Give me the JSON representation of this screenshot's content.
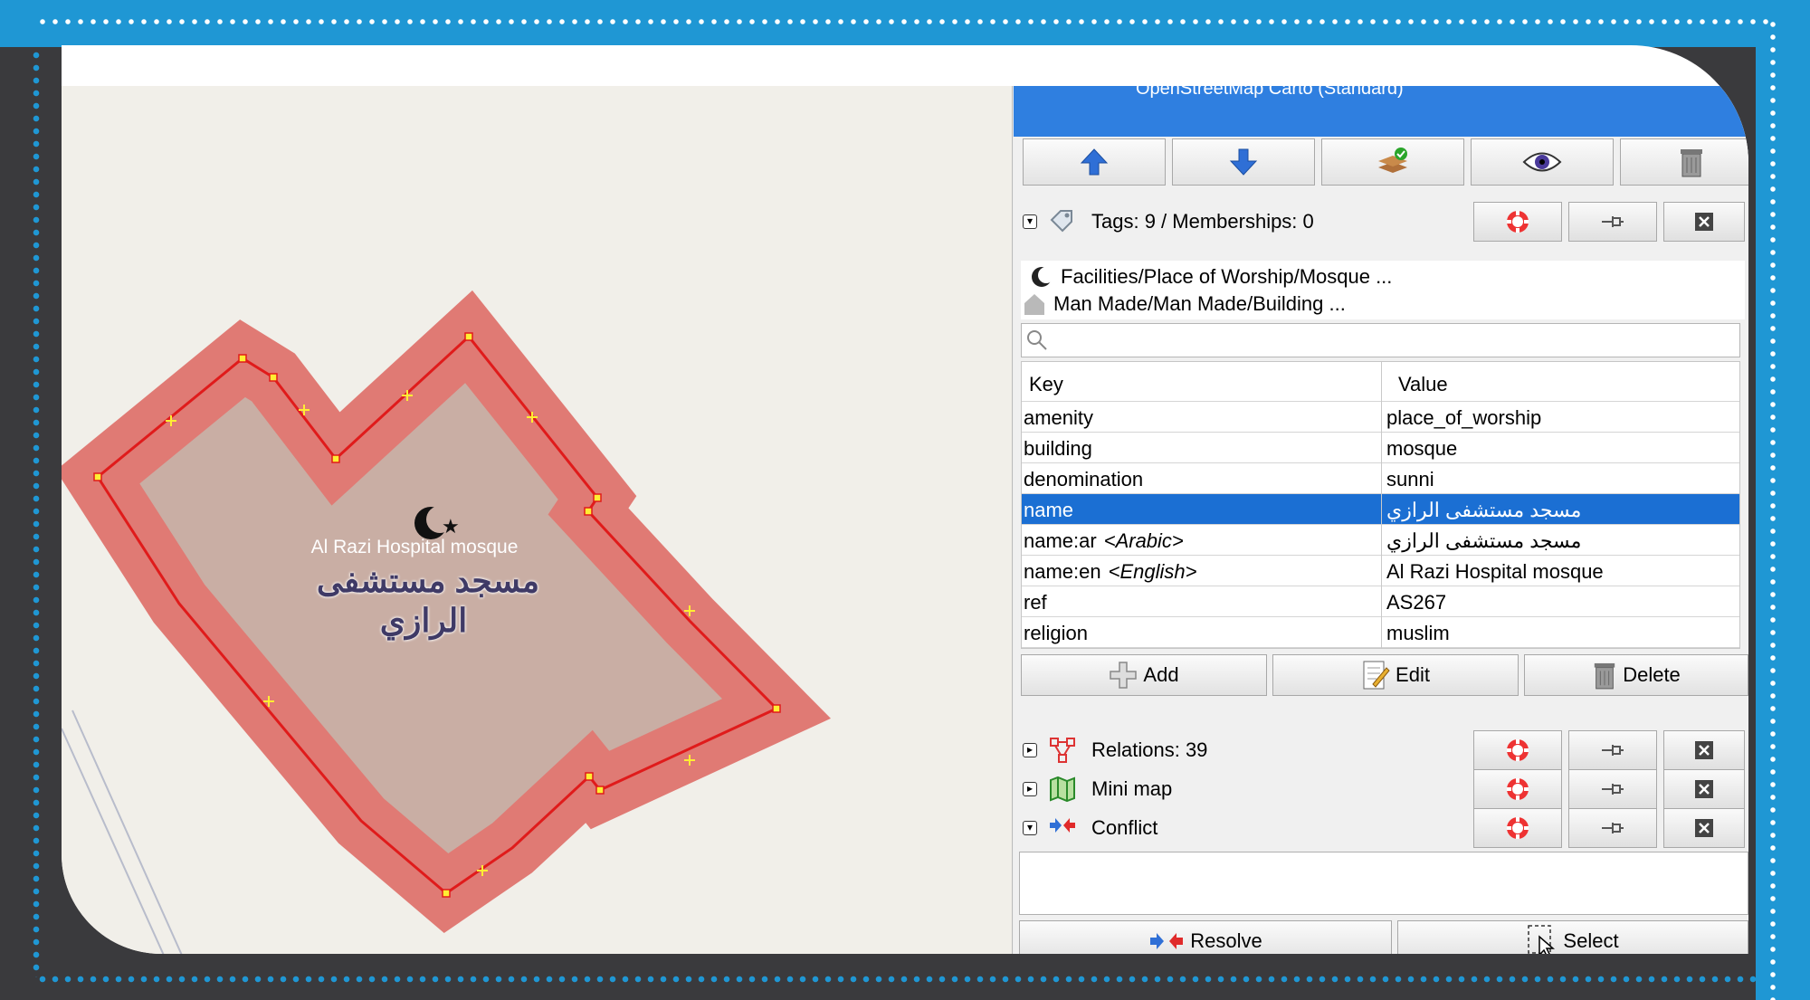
{
  "frame": {
    "accent": "#1f97d4",
    "background": "#3a3a3d"
  },
  "map": {
    "label_en": "Al Razi Hospital mosque",
    "label_ar_line1": "مسجد مستشفى",
    "label_ar_line2": "الرازي",
    "icon": "mosque-crescent-star-icon",
    "outline_color": "#e01b1b",
    "area_color": "#c4b3a6"
  },
  "layers": {
    "strip_text": "OpenStreetMap Carto (Standard)"
  },
  "toolbar": {
    "buttons": [
      {
        "name": "move-up-button",
        "icon": "arrow-up-icon"
      },
      {
        "name": "move-down-button",
        "icon": "arrow-down-icon"
      },
      {
        "name": "activate-layer-button",
        "icon": "layers-check-icon"
      },
      {
        "name": "toggle-visibility-button",
        "icon": "eye-icon"
      },
      {
        "name": "delete-layer-button",
        "icon": "trash-icon"
      }
    ]
  },
  "tags_panel": {
    "title": "Tags: 9 / Memberships: 0",
    "presets": [
      {
        "icon": "crescent-icon",
        "label": "Facilities/Place of Worship/Mosque ..."
      },
      {
        "icon": "house-icon",
        "label": "Man Made/Man Made/Building ..."
      }
    ],
    "search_placeholder": "",
    "columns": {
      "key": "Key",
      "value": "Value"
    },
    "rows": [
      {
        "key": "amenity",
        "hint": "",
        "value": "place_of_worship"
      },
      {
        "key": "building",
        "hint": "",
        "value": "mosque"
      },
      {
        "key": "denomination",
        "hint": "",
        "value": "sunni"
      },
      {
        "key": "name",
        "hint": "",
        "value": "مسجد مستشفى الرازي",
        "selected": true
      },
      {
        "key": "name:ar",
        "hint": "<Arabic>",
        "value": "مسجد مستشفى الرازي"
      },
      {
        "key": "name:en",
        "hint": "<English>",
        "value": "Al Razi Hospital mosque"
      },
      {
        "key": "ref",
        "hint": "",
        "value": "AS267"
      },
      {
        "key": "religion",
        "hint": "",
        "value": "muslim"
      }
    ],
    "add_label": "Add",
    "edit_label": "Edit",
    "delete_label": "Delete"
  },
  "relations_panel": {
    "title": "Relations: 39"
  },
  "minimap_panel": {
    "title": "Mini map"
  },
  "conflict_panel": {
    "title": "Conflict",
    "resolve_label": "Resolve",
    "select_label": "Select"
  }
}
